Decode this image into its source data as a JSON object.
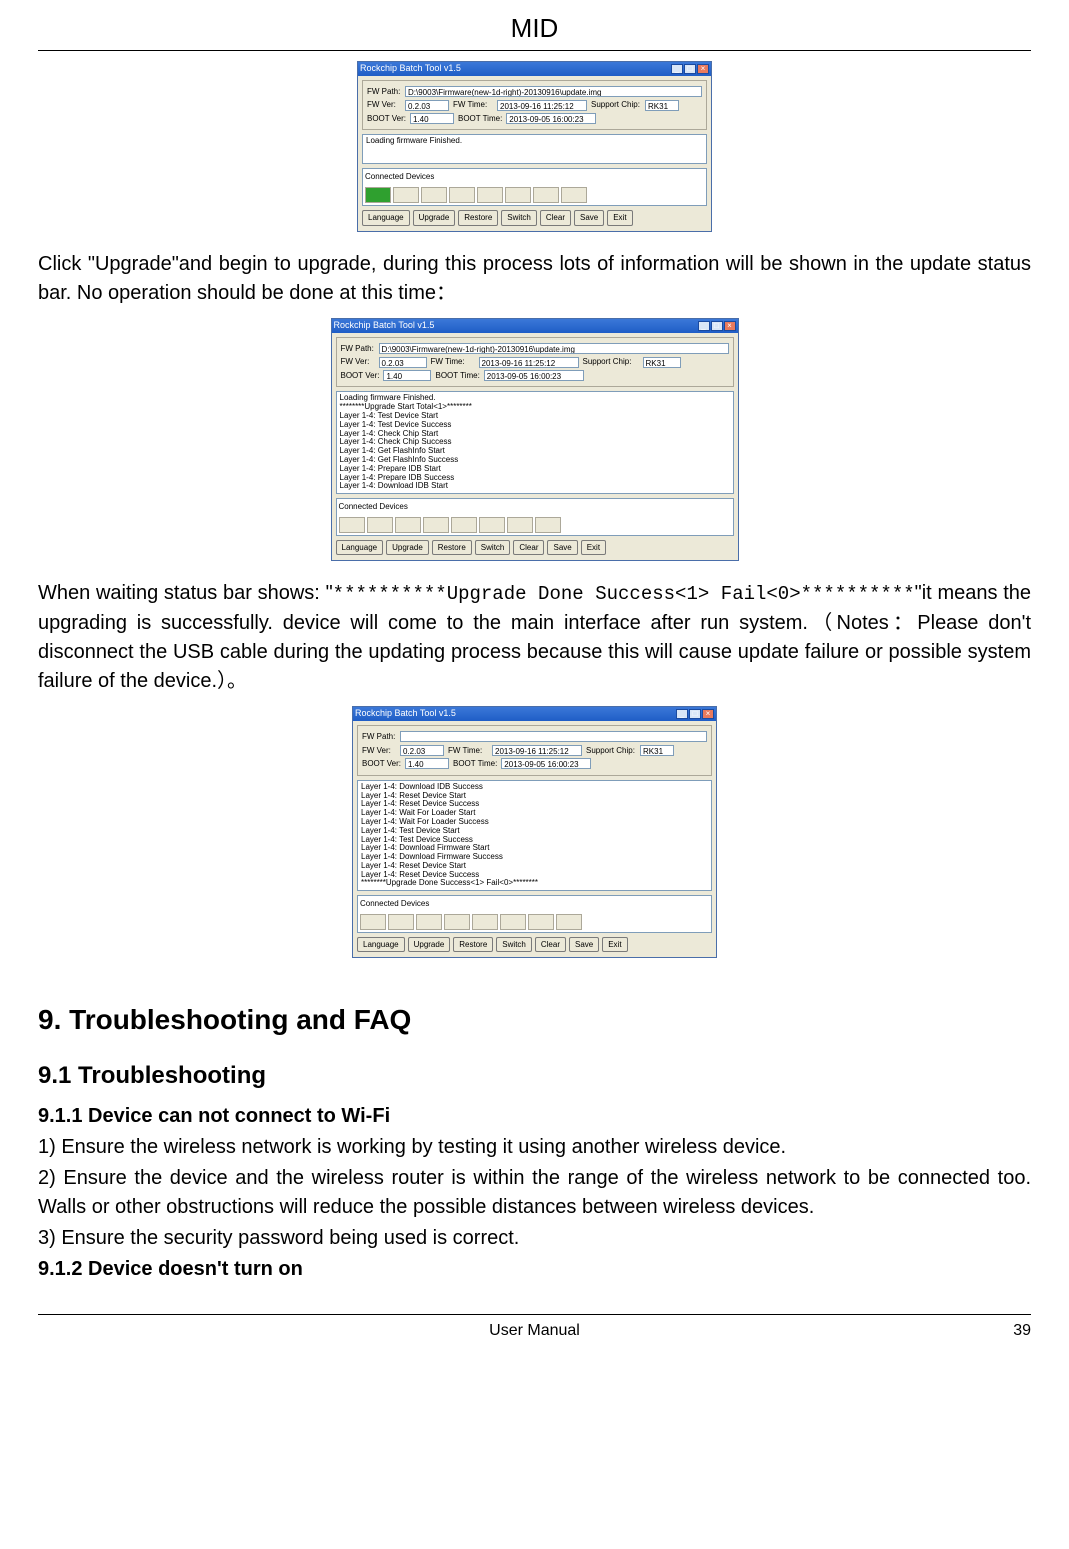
{
  "page_header": "MID",
  "footer_center": "User Manual",
  "footer_page": "39",
  "para1": "Click \"Upgrade\"and begin to upgrade, during this process lots of information will be shown in the update status bar. No operation should be done at this time：",
  "para2_pre": "When waiting status bar shows: \"",
  "para2_status": "**********Upgrade Done Success<1> Fail<0>**********",
  "para2_post": "\"it means the upgrading is successfully. device will come to the main interface after run system.（Notes：Please don't disconnect the USB cable during the updating process because this will cause update failure or possible system failure of the device.）。",
  "h1": "9. Troubleshooting and FAQ",
  "h2": "9.1 Troubleshooting",
  "s911_title": "9.1.1 Device can not connect to Wi-Fi",
  "s911_1": "1) Ensure the wireless network is working by testing it using another wireless device.",
  "s911_2": "2) Ensure the device and the wireless router is within the range of the wireless network to be connected too. Walls or other obstructions will reduce the possible distances between wireless devices.",
  "s911_3": "3) Ensure the security password being used is correct.",
  "s912_title": "9.1.2 Device doesn't turn on",
  "screenshot_common": {
    "title": "Rockchip Batch Tool v1.5",
    "labels": {
      "fw_path": "FW Path:",
      "fw_ver": "FW Ver:",
      "boot_ver": "BOOT Ver:",
      "fw_time": "FW Time:",
      "boot_time": "BOOT Time:",
      "support_chip": "Support Chip:",
      "conn_section": "Connected Devices"
    },
    "values": {
      "fw_ver": "0.2.03",
      "boot_ver": "1.40",
      "fw_time": "2013-09-16 11:25:12",
      "boot_time": "2013-09-05 16:00:23",
      "support_chip": "RK31",
      "fw_path_long": "D:\\9003\\Firmware(new-1d-right)-20130916\\update.img"
    },
    "buttons": [
      "Language",
      "Upgrade",
      "Restore",
      "Switch",
      "Clear",
      "Save",
      "Exit"
    ]
  },
  "screenshot1": {
    "status_text": "Loading firmware Finished."
  },
  "screenshot2": {
    "status_lines": [
      "Loading firmware Finished.",
      "********Upgrade Start Total<1>********",
      "Layer 1-4: Test Device Start",
      "Layer 1-4: Test Device Success",
      "Layer 1-4: Check Chip Start",
      "Layer 1-4: Check Chip Success",
      "Layer 1-4: Get FlashInfo Start",
      "Layer 1-4: Get FlashInfo Success",
      "Layer 1-4: Prepare IDB Start",
      "Layer 1-4: Prepare IDB Success",
      "Layer 1-4: Download IDB Start"
    ]
  },
  "screenshot3": {
    "status_lines": [
      "Layer 1-4: Download IDB Success",
      "Layer 1-4: Reset Device Start",
      "Layer 1-4: Reset Device Success",
      "Layer 1-4: Wait For Loader Start",
      "Layer 1-4: Wait For Loader Success",
      "Layer 1-4: Test Device Start",
      "Layer 1-4: Test Device Success",
      "Layer 1-4: Download Firmware Start",
      "Layer 1-4: Download Firmware Success",
      "Layer 1-4: Reset Device Start",
      "Layer 1-4: Reset Device Success",
      "********Upgrade Done Success<1> Fail<0>********"
    ]
  }
}
